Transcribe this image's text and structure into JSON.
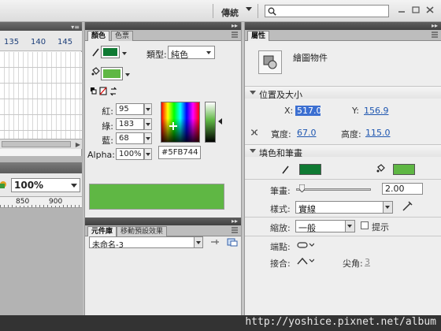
{
  "app": {
    "workspace": "傳統",
    "search_placeholder": ""
  },
  "timeline": {
    "frame_numbers": [
      "135",
      "140",
      "145"
    ]
  },
  "stage": {
    "zoom": "100%",
    "ruler_marks": [
      "850",
      "900"
    ]
  },
  "color_panel": {
    "tabs": [
      "顏色",
      "色票"
    ],
    "type_label": "類型:",
    "type_value": "純色",
    "red_label": "紅:",
    "red_value": "95",
    "green_label": "綠:",
    "green_value": "183",
    "blue_label": "藍:",
    "blue_value": "68",
    "alpha_label": "Alpha:",
    "alpha_value": "100%",
    "hex_value": "#5FB744",
    "stroke_color": "#0f7a33",
    "fill_color": "#5fb744"
  },
  "library_panel": {
    "tabs": [
      "元件庫",
      "移動預設效果"
    ],
    "document_select": "未命名-3"
  },
  "properties": {
    "tab": "屬性",
    "object_type": "繪圖物件",
    "position_section": "位置及大小",
    "x_label": "X:",
    "x_value": "517.0",
    "y_label": "Y:",
    "y_value": "156.9",
    "width_label": "寬度:",
    "width_value": "67.0",
    "height_label": "高度:",
    "height_value": "115.0",
    "fill_stroke_section": "填色和筆畫",
    "stroke_swatch_color": "#0f7a33",
    "fill_swatch_color": "#5fb744",
    "stroke_weight_label": "筆畫:",
    "stroke_weight_value": "2.00",
    "style_label": "樣式:",
    "style_value": "實線",
    "scale_label": "縮放:",
    "scale_value": "一般",
    "hint_label": "提示",
    "cap_label": "端點:",
    "join_label": "接合:",
    "miter_label": "尖角:",
    "miter_value": "3"
  },
  "watermark": "http://yoshice.pixnet.net/album"
}
